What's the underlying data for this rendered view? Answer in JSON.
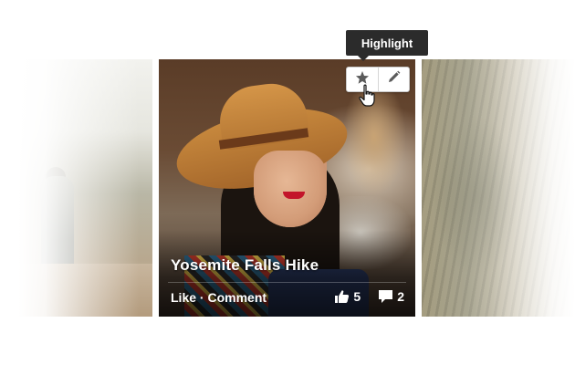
{
  "tooltip": {
    "text": "Highlight"
  },
  "photo": {
    "title": "Yosemite Falls Hike",
    "like_label": "Like",
    "separator": "·",
    "comment_label": "Comment",
    "likes_count": "5",
    "comments_count": "2"
  },
  "icons": {
    "highlight": "star-icon",
    "edit": "pencil-icon",
    "likes": "thumbs-up-icon",
    "comments": "speech-bubble-icon",
    "cursor": "hand-pointer-icon"
  },
  "colors": {
    "tooltip_bg": "#2b2b2b",
    "button_bg": "#ffffff",
    "caption_text": "#ffffff"
  }
}
